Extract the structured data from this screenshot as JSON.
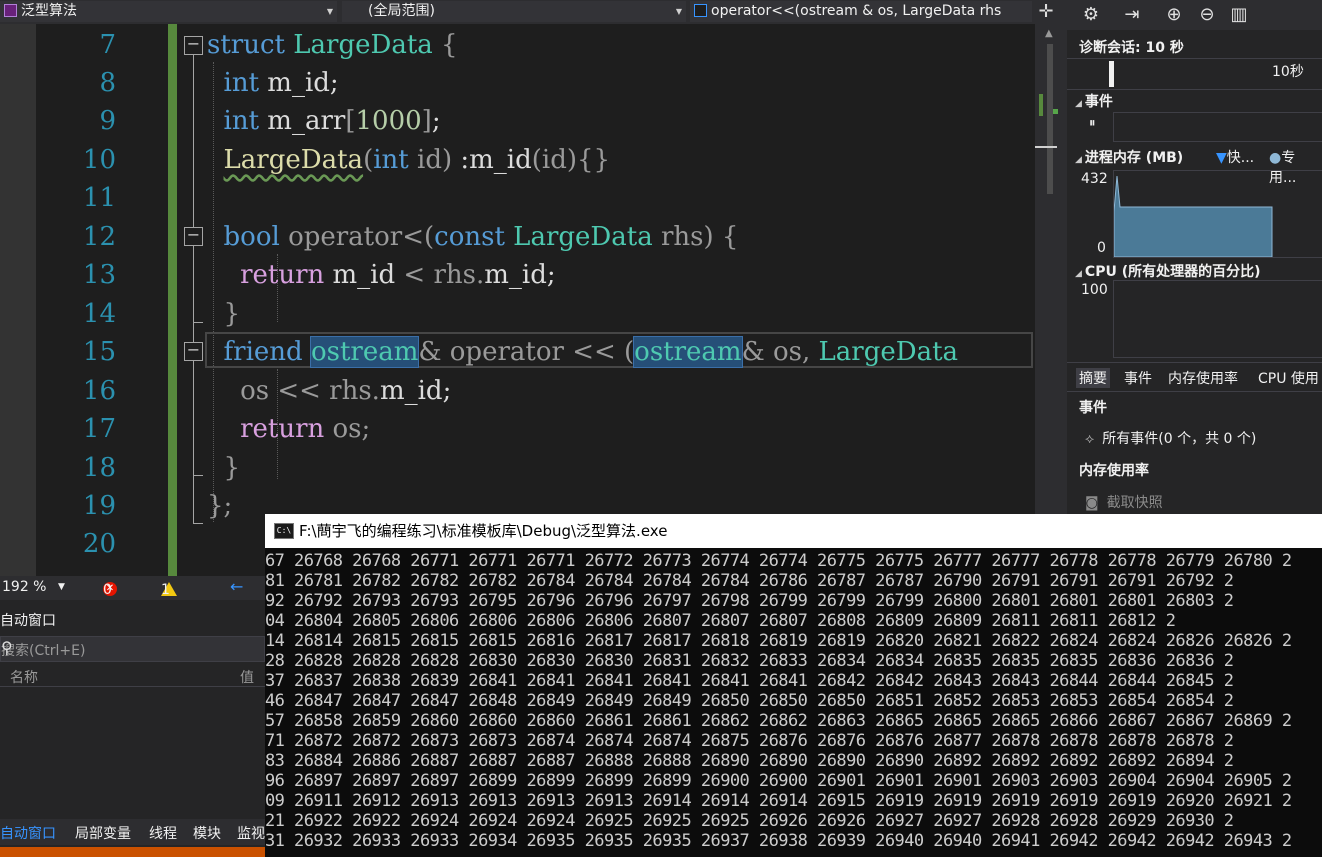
{
  "topbar": {
    "project": "泛型算法",
    "scope": "(全局范围)",
    "member": "operator<<(ostream & os, LargeData rhs"
  },
  "editor": {
    "line_numbers": [
      "7",
      "8",
      "9",
      "10",
      "11",
      "12",
      "13",
      "14",
      "15",
      "16",
      "17",
      "18",
      "19",
      "20"
    ],
    "zoom": "192 %",
    "errors": "0",
    "warnings": "1"
  },
  "autos": {
    "title": "自动窗口",
    "search_placeholder": "搜索(Ctrl+E)",
    "col_name": "名称",
    "col_value": "值",
    "tabs": [
      "自动窗口",
      "局部变量",
      "线程",
      "模块",
      "监视"
    ]
  },
  "diagnostics": {
    "session": "诊断会话: 10 秒",
    "timeline_label": "10秒",
    "events_title": "事件",
    "memory_title": "进程内存 (MB)",
    "memory_legend_snapshot": "快...",
    "memory_legend_private": "专用...",
    "memory_max": "432",
    "memory_min": "0",
    "cpu_title": "CPU (所有处理器的百分比)",
    "cpu_max": "100",
    "tabs": [
      "摘要",
      "事件",
      "内存使用率",
      "CPU 使用"
    ],
    "events_section": "事件",
    "all_events": "所有事件(0 个，共 0 个)",
    "memory_usage_section": "内存使用率",
    "snapshot_button": "截取快照"
  },
  "console": {
    "title": "F:\\蔄宇飞的编程练习\\标准模板库\\Debug\\泛型算法.exe",
    "lines": [
      "67 26768 26768 26771 26771 26771 26772 26773 26774 26774 26775 26775 26777 26777 26778 26778 26779 26780 2",
      "81 26781 26782 26782 26782 26784 26784 26784 26784 26786 26787 26787 26790 26791 26791 26791 26792 2",
      "92 26792 26793 26793 26795 26796 26796 26797 26798 26799 26799 26799 26800 26801 26801 26801 26803 2",
      "04 26804 26805 26806 26806 26806 26806 26807 26807 26807 26808 26809 26809 26811 26811 26812 2",
      "14 26814 26815 26815 26815 26816 26817 26817 26818 26819 26819 26820 26821 26822 26824 26824 26826 26826 2",
      "28 26828 26828 26828 26830 26830 26830 26831 26832 26833 26834 26834 26835 26835 26835 26836 26836 2",
      "37 26837 26838 26839 26841 26841 26841 26841 26841 26841 26842 26842 26843 26843 26844 26844 26845 2",
      "46 26847 26847 26847 26848 26849 26849 26849 26850 26850 26850 26851 26852 26853 26853 26854 26854 2",
      "57 26858 26859 26860 26860 26860 26861 26861 26862 26862 26863 26865 26865 26865 26866 26867 26867 26869 2",
      "71 26872 26872 26873 26873 26874 26874 26874 26875 26876 26876 26876 26877 26878 26878 26878 26878 2",
      "83 26884 26886 26887 26887 26887 26888 26888 26890 26890 26890 26890 26892 26892 26892 26892 26894 2",
      "96 26897 26897 26897 26899 26899 26899 26899 26900 26900 26901 26901 26901 26903 26903 26904 26904 26905 2",
      "09 26911 26912 26913 26913 26913 26913 26914 26914 26914 26915 26919 26919 26919 26919 26919 26920 26921 2",
      "21 26922 26922 26924 26924 26924 26925 26925 26925 26926 26926 26927 26927 26928 26928 26929 26930 2",
      "31 26932 26933 26933 26934 26935 26935 26935 26937 26938 26939 26940 26940 26941 26942 26942 26942 26943 2"
    ]
  },
  "colors": {
    "keyword": "#569cd6",
    "type": "#4ec9b0",
    "line_number": "#2b91af",
    "control": "#d8a0df",
    "change_bar": "#57893d",
    "memory_fill": "#4b7a97"
  }
}
